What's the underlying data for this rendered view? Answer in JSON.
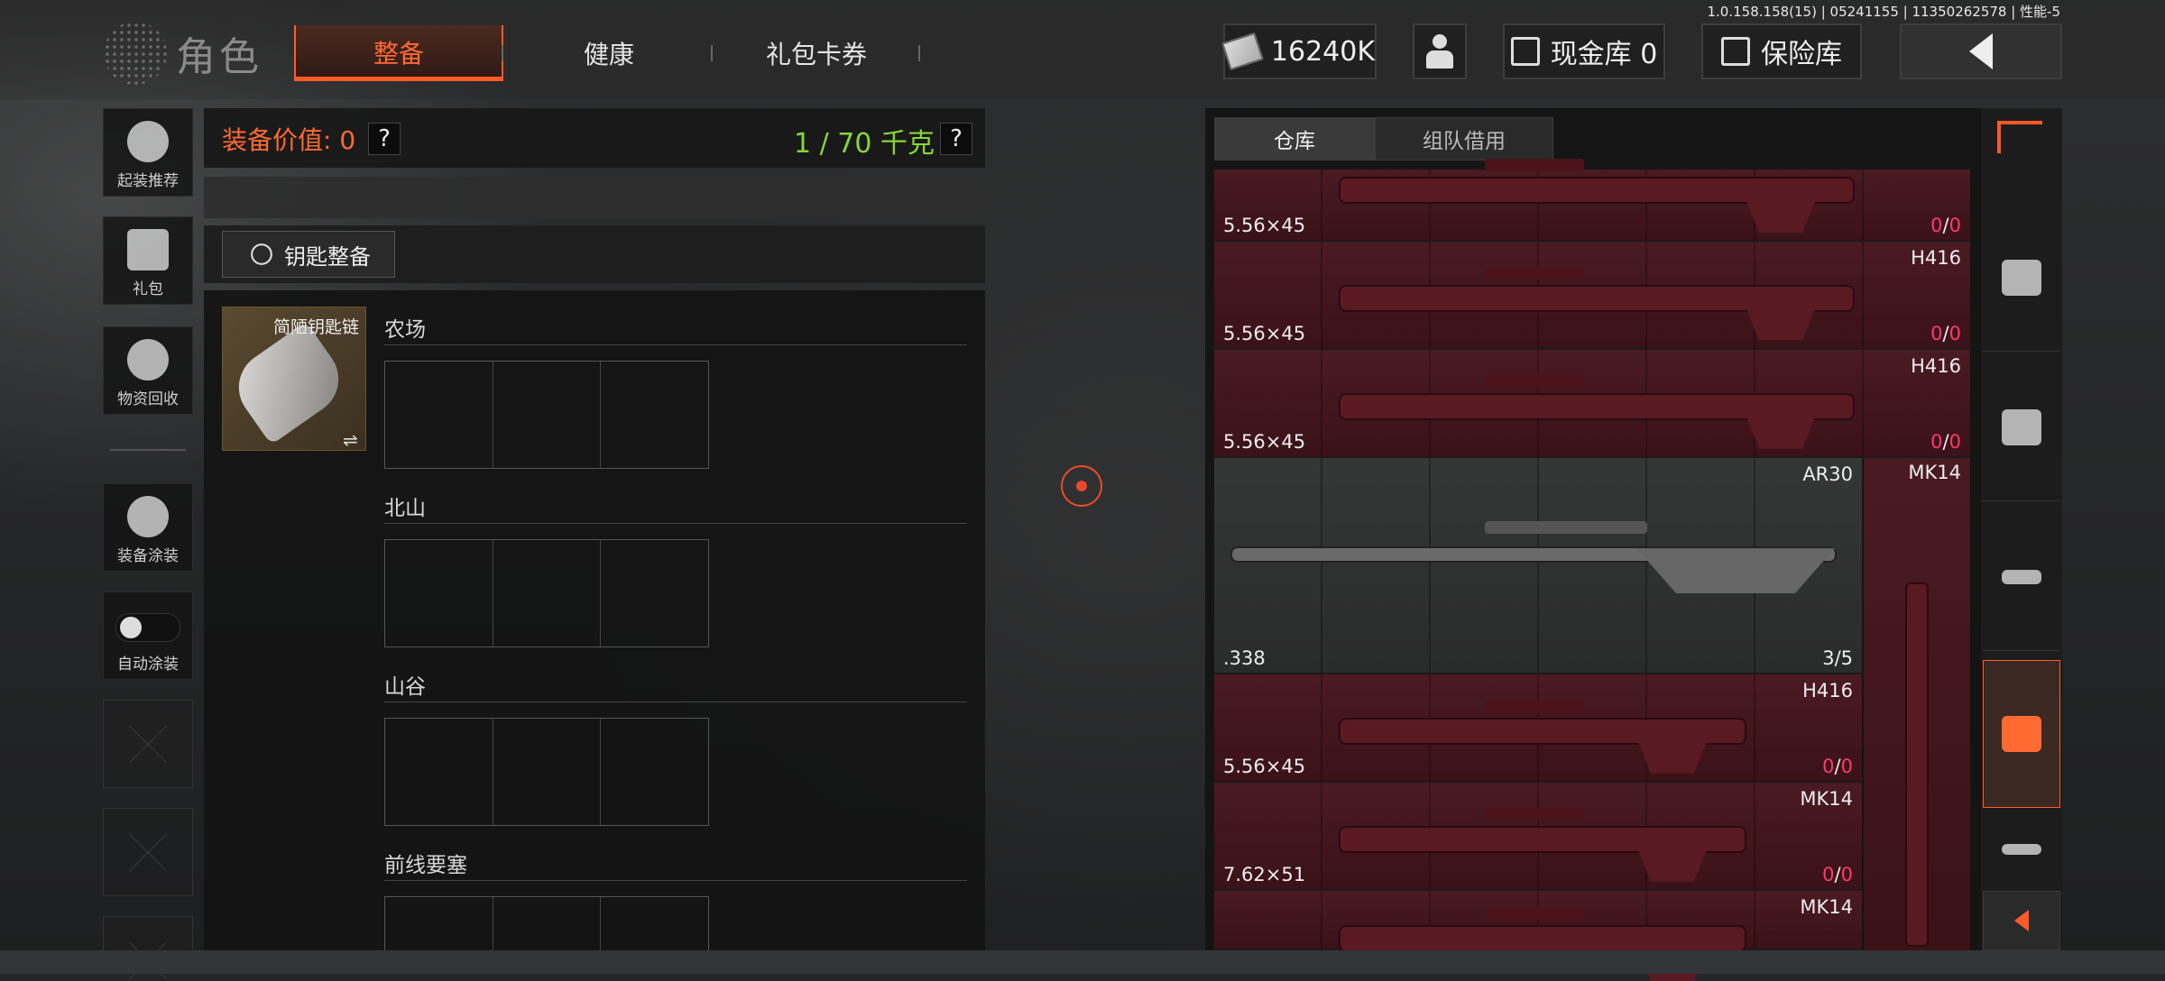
{
  "version": "1.0.158.158(15) | 05241155 | 11350262578 | 性能-5",
  "header": {
    "title": "角色",
    "tabs": [
      {
        "label": "整备",
        "active": true
      },
      {
        "label": "健康",
        "active": false
      },
      {
        "label": "礼包卡券",
        "active": false
      }
    ],
    "money": "16240K",
    "cash_vault": "现金库 0",
    "insurance": "保险库",
    "back_icon": "chevron-left-icon"
  },
  "sidebar": {
    "items": [
      {
        "label": "起装推荐",
        "icon": "helmet-icon"
      },
      {
        "label": "礼包",
        "icon": "gift-icon"
      },
      {
        "label": "物资回收",
        "icon": "recycle-icon"
      },
      {
        "label": "装备涂装",
        "icon": "paint-icon"
      },
      {
        "label": "自动涂装",
        "icon": "toggle-icon",
        "toggle_on": false
      }
    ]
  },
  "equipment": {
    "value_label": "装备价值: 0",
    "weight": "1 / 70 千克",
    "help": "?",
    "key_button": "钥匙整备",
    "keychain_name": "简陋钥匙链",
    "swap": "⇌",
    "maps": [
      "农场",
      "北山",
      "山谷",
      "前线要塞"
    ]
  },
  "warehouse": {
    "tabs": [
      "仓库",
      "组队借用"
    ],
    "items": [
      {
        "caliber": "5.56×45",
        "name": "",
        "dur_a": "0",
        "dur_b": "0"
      },
      {
        "caliber": "5.56×45",
        "name": "H416",
        "dur_a": "0",
        "dur_b": "0"
      },
      {
        "caliber": "5.56×45",
        "name": "H416",
        "dur_a": "0",
        "dur_b": "0"
      },
      {
        "caliber": ".338",
        "name": "AR30",
        "durability": "3/5"
      },
      {
        "caliber": "5.56×45",
        "name": "H416",
        "dur_a": "0",
        "dur_b": "0"
      },
      {
        "caliber": "7.62×51",
        "name": "MK14",
        "dur_a": "0",
        "dur_b": "0"
      },
      {
        "caliber": "",
        "name": "MK14"
      }
    ],
    "tall_item": {
      "name": "MK14"
    }
  },
  "rail": {
    "icons": [
      "sort-icon",
      "crate-icon",
      "shirt-icon",
      "rifle-icon",
      "vest-icon",
      "sniper-icon"
    ],
    "active_index": 4
  },
  "colors": {
    "accent": "#ff5a2a",
    "weight_green": "#86d63a",
    "broken_red": "#ff3a6a"
  }
}
